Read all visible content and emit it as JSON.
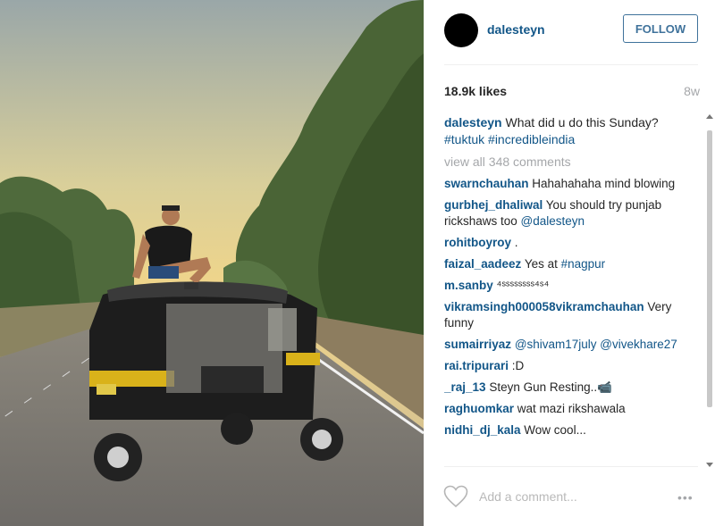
{
  "post": {
    "username": "dalesteyn",
    "follow_label": "FOLLOW",
    "likes": "18.9k likes",
    "age": "8w",
    "caption": {
      "user": "dalesteyn",
      "text": "What did u do this Sunday?",
      "hashtags": "#tuktuk #incredibleindia"
    },
    "view_all": "view all 348 comments",
    "comments": [
      {
        "user": "swarnchauhan",
        "text": "Hahahahaha mind blowing"
      },
      {
        "user": "gurbhej_dhaliwal",
        "text": "You should try punjab rickshaws too ",
        "mention": "@dalesteyn"
      },
      {
        "user": "rohitboyroy",
        "text": "."
      },
      {
        "user": "faizal_aadeez",
        "text": "Yes at ",
        "mention": "#nagpur"
      },
      {
        "user": "m.sanby",
        "text": "⁴ˢˢˢˢˢˢˢˢ⁴ˢ⁴"
      },
      {
        "user": "vikramsingh000058vikramchauhan",
        "text": "Very funny"
      },
      {
        "user": "sumairriyaz",
        "text": "",
        "mention": "@shivam17july @vivekhare27"
      },
      {
        "user": "rai.tripurari",
        "text": ":D"
      },
      {
        "user": "_raj_13",
        "text": "Steyn Gun Resting..📹"
      },
      {
        "user": "raghuomkar",
        "text": "wat mazi rikshawala"
      },
      {
        "user": "nidhi_dj_kala",
        "text": "Wow cool..."
      }
    ],
    "add_comment_placeholder": "Add a comment...",
    "more_label": "•••"
  },
  "icons": {
    "like": "heart-icon",
    "more": "ellipsis-icon"
  },
  "colors": {
    "link": "#125688",
    "follow": "#3f729b",
    "muted": "#a5a7aa"
  }
}
